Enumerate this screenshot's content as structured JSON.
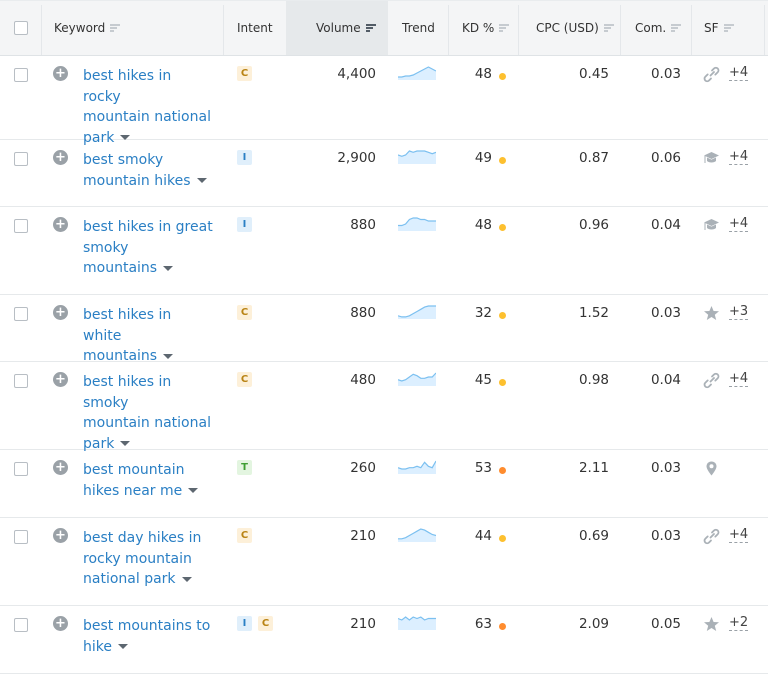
{
  "header": {
    "select_all": "",
    "columns": {
      "keyword": "Keyword",
      "intent": "Intent",
      "volume": "Volume",
      "trend": "Trend",
      "kd": "KD %",
      "cpc": "CPC (USD)",
      "com": "Com.",
      "sf": "SF"
    },
    "sorted_column": "volume"
  },
  "colors": {
    "link": "#2a7fc4",
    "kd_yellow": "#fdc02f",
    "kd_orange": "#ff8c2e",
    "trend_line": "#7cc0f0",
    "trend_fill": "#dcefff",
    "intent_commercial_bg": "#fdf0d9",
    "intent_informational_bg": "#e0effb",
    "intent_transactional_bg": "#e3f5e0"
  },
  "rows": [
    {
      "keyword_lines": [
        "best hikes in rocky",
        "mountain national",
        "park"
      ],
      "intents": [
        "C"
      ],
      "volume": "4,400",
      "trend": [
        2,
        2,
        3,
        3,
        4,
        6,
        8,
        10,
        12,
        10,
        8
      ],
      "kd": "48",
      "kd_level": "yellow",
      "cpc": "0.45",
      "com": "0.03",
      "sf_icon": "link-icon",
      "sf_more": "+4"
    },
    {
      "keyword_lines": [
        "best smoky",
        "mountain hikes"
      ],
      "intents": [
        "I"
      ],
      "volume": "2,900",
      "trend": [
        6,
        5,
        6,
        9,
        8,
        9,
        9,
        9,
        8,
        7,
        8
      ],
      "kd": "49",
      "kd_level": "yellow",
      "cpc": "0.87",
      "com": "0.06",
      "sf_icon": "graduation-cap-icon",
      "sf_more": "+4"
    },
    {
      "keyword_lines": [
        "best hikes in great",
        "smoky",
        "mountains"
      ],
      "intents": [
        "I"
      ],
      "volume": "880",
      "trend": [
        3,
        3,
        4,
        7,
        8,
        8,
        7,
        7,
        6,
        6,
        6
      ],
      "kd": "48",
      "kd_level": "yellow",
      "cpc": "0.96",
      "com": "0.04",
      "sf_icon": "graduation-cap-icon",
      "sf_more": "+4"
    },
    {
      "keyword_lines": [
        "best hikes in white",
        "mountains"
      ],
      "intents": [
        "C"
      ],
      "volume": "880",
      "trend": [
        2,
        1,
        1,
        2,
        4,
        6,
        8,
        10,
        11,
        11,
        11
      ],
      "kd": "32",
      "kd_level": "yellow",
      "cpc": "1.52",
      "com": "0.03",
      "sf_icon": "star-icon",
      "sf_more": "+3"
    },
    {
      "keyword_lines": [
        "best hikes in smoky",
        "mountain national",
        "park"
      ],
      "intents": [
        "C"
      ],
      "volume": "480",
      "trend": [
        4,
        3,
        4,
        6,
        8,
        7,
        5,
        5,
        6,
        6,
        9
      ],
      "kd": "45",
      "kd_level": "yellow",
      "cpc": "0.98",
      "com": "0.04",
      "sf_icon": "link-icon",
      "sf_more": "+4"
    },
    {
      "keyword_lines": [
        "best mountain",
        "hikes near me"
      ],
      "intents": [
        "T"
      ],
      "volume": "260",
      "trend": [
        4,
        3,
        3,
        4,
        4,
        5,
        4,
        8,
        5,
        4,
        9
      ],
      "kd": "53",
      "kd_level": "orange",
      "cpc": "2.11",
      "com": "0.03",
      "sf_icon": "map-pin-icon",
      "sf_more": ""
    },
    {
      "keyword_lines": [
        "best day hikes in",
        "rocky mountain",
        "national park"
      ],
      "intents": [
        "C"
      ],
      "volume": "210",
      "trend": [
        2,
        2,
        3,
        5,
        7,
        9,
        11,
        10,
        8,
        6,
        5
      ],
      "kd": "44",
      "kd_level": "yellow",
      "cpc": "0.69",
      "com": "0.03",
      "sf_icon": "link-icon",
      "sf_more": "+4"
    },
    {
      "keyword_lines": [
        "best mountains to",
        "hike"
      ],
      "intents": [
        "I",
        "C"
      ],
      "volume": "210",
      "trend": [
        7,
        6,
        8,
        6,
        8,
        7,
        8,
        6,
        7,
        7,
        7
      ],
      "kd": "63",
      "kd_level": "orange",
      "cpc": "2.09",
      "com": "0.05",
      "sf_icon": "star-icon",
      "sf_more": "+2"
    }
  ]
}
